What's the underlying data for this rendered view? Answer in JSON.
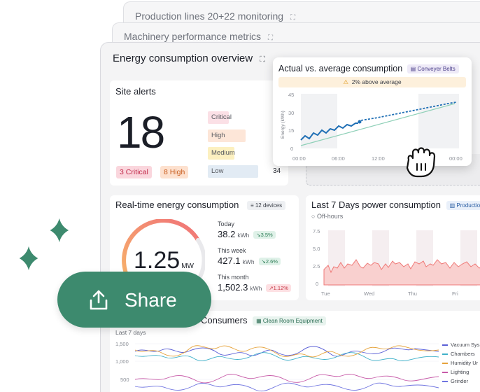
{
  "cards": {
    "production_title": "Production lines 20+22 monitoring",
    "machinery_title": "Machinery performance metrics",
    "main_title": "Energy consumption overview"
  },
  "site_alerts": {
    "title": "Site alerts",
    "total": "18",
    "critical_pill": "3 Critical",
    "high_pill": "8 High",
    "levels": [
      "Critical",
      "High",
      "Medium",
      "Low"
    ],
    "low_count": "34"
  },
  "popup": {
    "title": "Actual vs. average consumption",
    "tag": "Conveyer Belts",
    "warning": "2% above average",
    "ylabel": "Energy (kWh)",
    "yticks": [
      "45",
      "30",
      "15",
      "0"
    ],
    "xticks": [
      "00:00",
      "06:00",
      "12:00",
      "00:00"
    ]
  },
  "realtime": {
    "title": "Real-time energy consumption",
    "devices": "12 devices",
    "gauge_value": "1.25",
    "gauge_unit": "MW",
    "stats": [
      {
        "label": "Today",
        "value": "38.2",
        "unit": "kWh",
        "change": "3.5%"
      },
      {
        "label": "This week",
        "value": "427.1",
        "unit": "kWh",
        "change": "2.6%"
      },
      {
        "label": "This month",
        "value": "1,502.3",
        "unit": "kWh",
        "change": "1.12%"
      }
    ]
  },
  "last7": {
    "title": "Last 7 Days power consumption",
    "tag": "Production",
    "offhours": "Off-hours",
    "yticks": [
      "7.5",
      "5.0",
      "2.5",
      "0"
    ],
    "xticks": [
      "Tue",
      "Wed",
      "Thu",
      "Fri"
    ]
  },
  "consumers": {
    "title": "Consumers",
    "tag": "Clean Room Equipment",
    "subtitle": "Last 7 days",
    "yticks": [
      "1,500",
      "1,000",
      "500"
    ],
    "legend": [
      "Vacuum Sys",
      "Chambers",
      "Humidity Ur",
      "Lighting",
      "Grinder"
    ]
  },
  "share": {
    "label": "Share"
  },
  "colors": {
    "accent_green": "#3d8a6e",
    "line_blue": "#1f6fb5",
    "area_red": "#f08c8c",
    "critical": "#f8d7df",
    "high": "#fde2d2",
    "medium": "#fcefb9",
    "low": "#e3ecf5"
  }
}
